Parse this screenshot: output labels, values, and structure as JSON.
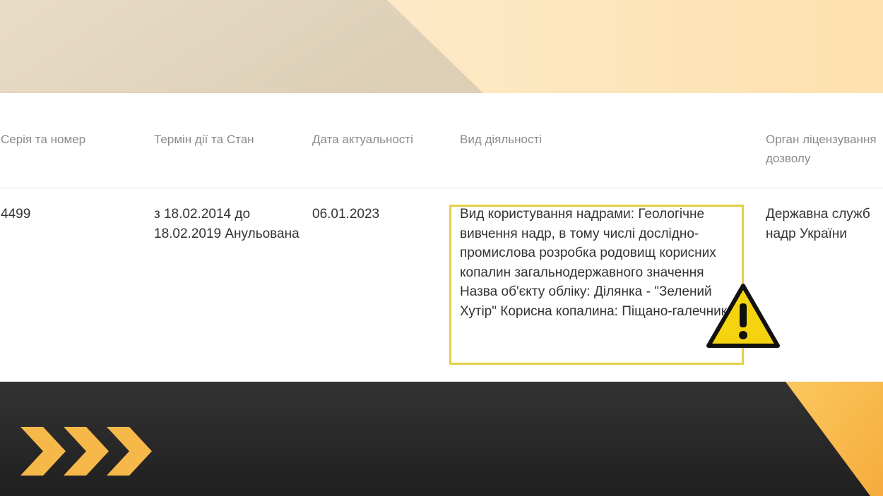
{
  "table": {
    "headers": {
      "series_number": "Серія та номер",
      "term_status": "Термін дії та Стан",
      "actuality_date": "Дата актуальності",
      "activity_type": "Вид діяльності",
      "licensing_body": "Орган ліцензування дозволу"
    },
    "row": {
      "series_number": "4499",
      "term_status": "з 18.02.2014 до 18.02.2019 Анульована",
      "actuality_date": "06.01.2023",
      "activity_type": "Вид користування надрами: Геологічне вивчення надр, в тому числі дослідно-промислова розробка родовищ корисних копалин загальнодержавного значення Назва об'єкту обліку: Ділянка - \"Зелений Хутір\" Корисна копалина: Піщано-галечник",
      "licensing_body_line1": "Державна служб",
      "licensing_body_line2": "надр України"
    }
  },
  "decor": {
    "warning_icon": "warning-triangle-icon",
    "chevrons_icon": "triple-chevron-right-icon",
    "colors": {
      "highlight_border": "#e4cf45",
      "accent_orange": "#f7b84a",
      "dark_bg": "#2b2b2b"
    }
  }
}
